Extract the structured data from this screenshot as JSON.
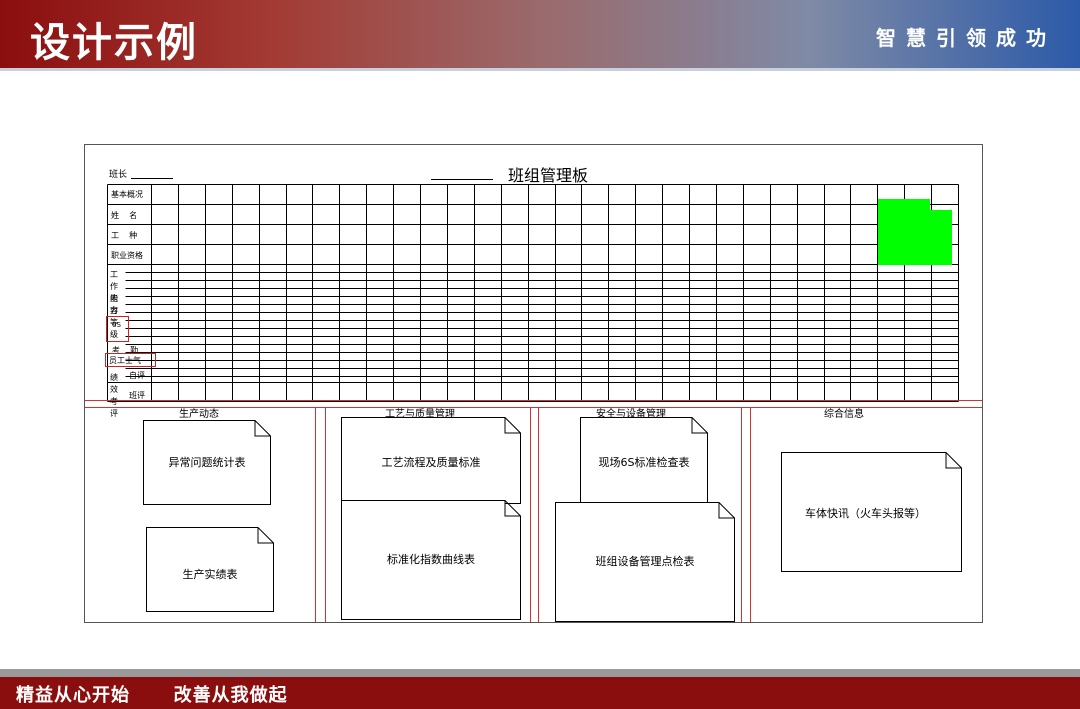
{
  "header": {
    "title": "设计示例",
    "slogan": "智慧引领成功"
  },
  "footer": {
    "slogan": "精益从心开始      改善从我做起"
  },
  "board": {
    "title": "班组管理板",
    "leader_label": "班长",
    "row_labels": {
      "basic": "基本概况",
      "name": "姓    名",
      "trade": "工    种",
      "qualification": "职业资格",
      "work_content": "工作内容",
      "ability": "能力等级",
      "six_s": "6S",
      "attendance": "考    勤",
      "morale": "员工士气",
      "performance": "绩效考评",
      "self_eval": "自评",
      "team_eval": "班评"
    },
    "sections": [
      {
        "title": "生产动态",
        "docs": [
          "异常问题统计表",
          "生产实绩表"
        ]
      },
      {
        "title": "工艺与质量管理",
        "docs": [
          "工艺流程及质量标准",
          "标准化指数曲线表"
        ]
      },
      {
        "title": "安全与设备管理",
        "docs": [
          "现场6S标准检查表",
          "班组设备管理点检表"
        ]
      },
      {
        "title": "综合信息",
        "docs": [
          "车体快讯（火车头报等）"
        ]
      }
    ]
  }
}
